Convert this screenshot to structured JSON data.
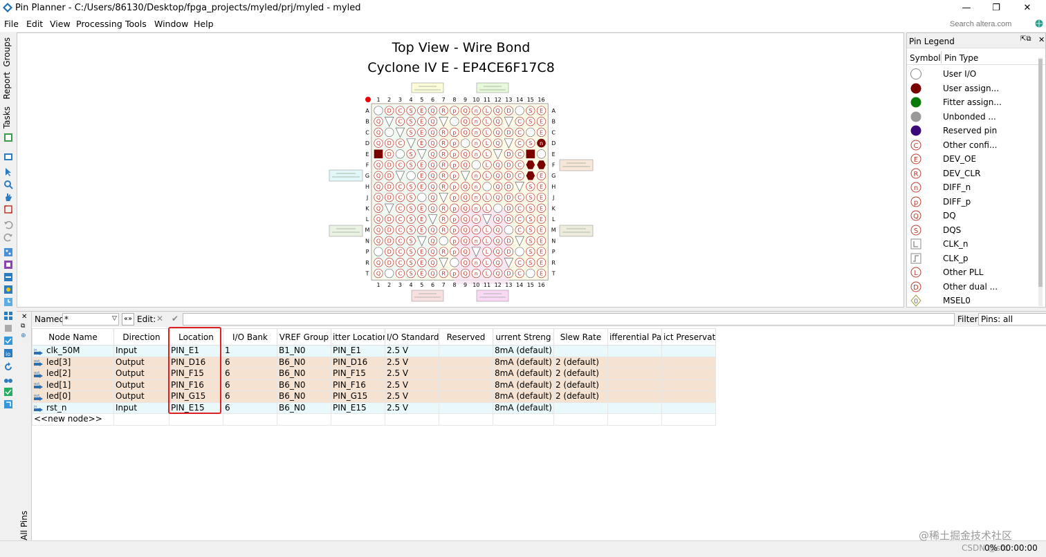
{
  "window": {
    "title": "Pin Planner - C:/Users/86130/Desktop/fpga_projects/myled/prj/myled - myled",
    "minimize": "—",
    "maximize": "❐",
    "close": "✕"
  },
  "menu": [
    "File",
    "Edit",
    "View",
    "Processing",
    "Tools",
    "Window",
    "Help"
  ],
  "search": {
    "placeholder": "Search altera.com"
  },
  "left_tabs": [
    "Groups",
    "Report",
    "Tasks"
  ],
  "top_view": {
    "title": "Top View - Wire Bond",
    "subtitle": "Cyclone IV E - EP4CE6F17C8",
    "columns": [
      "1",
      "2",
      "3",
      "4",
      "5",
      "6",
      "7",
      "8",
      "9",
      "10",
      "11",
      "12",
      "13",
      "14",
      "15",
      "16"
    ],
    "rows": [
      "A",
      "B",
      "C",
      "D",
      "E",
      "F",
      "G",
      "H",
      "J",
      "K",
      "L",
      "M",
      "N",
      "P",
      "R",
      "T"
    ]
  },
  "legend": {
    "title": "Pin Legend",
    "col_symbol": "Symbol",
    "col_type": "Pin Type",
    "items": [
      {
        "label": "User I/O",
        "sym": "circle-empty"
      },
      {
        "label": "User assign...",
        "sym": "circle-darkred"
      },
      {
        "label": "Fitter assign...",
        "sym": "circle-green"
      },
      {
        "label": "Unbonded ...",
        "sym": "circle-gray"
      },
      {
        "label": "Reserved pin",
        "sym": "circle-purple"
      },
      {
        "label": "Other confi...",
        "sym": "C"
      },
      {
        "label": "DEV_OE",
        "sym": "E"
      },
      {
        "label": "DEV_CLR",
        "sym": "R"
      },
      {
        "label": "DIFF_n",
        "sym": "n"
      },
      {
        "label": "DIFF_p",
        "sym": "p"
      },
      {
        "label": "DQ",
        "sym": "Q"
      },
      {
        "label": "DQS",
        "sym": "S"
      },
      {
        "label": "CLK_n",
        "sym": "clkn"
      },
      {
        "label": "CLK_p",
        "sym": "clkp"
      },
      {
        "label": "Other PLL",
        "sym": "L"
      },
      {
        "label": "Other dual ...",
        "sym": "D"
      },
      {
        "label": "MSEL0",
        "sym": "0"
      }
    ]
  },
  "all_pins": {
    "side_label": "All Pins",
    "named_label": "Named:",
    "named_value": "*",
    "edit_label": "Edit:",
    "filter_label": "Filter:",
    "filter_value": "Pins: all",
    "headers": [
      "Node Name",
      "Direction",
      "Location",
      "I/O Bank",
      "VREF Group",
      "Fitter Location",
      "I/O Standard",
      "Reserved",
      "Current Strength",
      "Slew Rate",
      "Differential Pair",
      "Strict Preservation"
    ],
    "headers_display": [
      "Node Name",
      "Direction",
      "Location",
      "I/O Bank",
      "VREF Group",
      "itter Locatior",
      "I/O Standard",
      "Reserved",
      "urrent Streng",
      "Slew Rate",
      "ifferential Pai",
      "ict Preservati"
    ],
    "rows": [
      {
        "dir_icon": "in",
        "name": "clk_50M",
        "direction": "Input",
        "location": "PIN_E1",
        "bank": "1",
        "vref": "B1_N0",
        "fitter": "PIN_E1",
        "std": "2.5 V",
        "reserved": "",
        "strength": "8mA (default)",
        "slew": "",
        "diff": "",
        "strict": ""
      },
      {
        "dir_icon": "out",
        "name": "led[3]",
        "direction": "Output",
        "location": "PIN_D16",
        "bank": "6",
        "vref": "B6_N0",
        "fitter": "PIN_D16",
        "std": "2.5 V",
        "reserved": "",
        "strength": "8mA (default)",
        "slew": "2 (default)",
        "diff": "",
        "strict": ""
      },
      {
        "dir_icon": "out",
        "name": "led[2]",
        "direction": "Output",
        "location": "PIN_F15",
        "bank": "6",
        "vref": "B6_N0",
        "fitter": "PIN_F15",
        "std": "2.5 V",
        "reserved": "",
        "strength": "8mA (default)",
        "slew": "2 (default)",
        "diff": "",
        "strict": ""
      },
      {
        "dir_icon": "out",
        "name": "led[1]",
        "direction": "Output",
        "location": "PIN_F16",
        "bank": "6",
        "vref": "B6_N0",
        "fitter": "PIN_F16",
        "std": "2.5 V",
        "reserved": "",
        "strength": "8mA (default)",
        "slew": "2 (default)",
        "diff": "",
        "strict": ""
      },
      {
        "dir_icon": "out",
        "name": "led[0]",
        "direction": "Output",
        "location": "PIN_G15",
        "bank": "6",
        "vref": "B6_N0",
        "fitter": "PIN_G15",
        "std": "2.5 V",
        "reserved": "",
        "strength": "8mA (default)",
        "slew": "2 (default)",
        "diff": "",
        "strict": ""
      },
      {
        "dir_icon": "in",
        "name": "rst_n",
        "direction": "Input",
        "location": "PIN_E15",
        "bank": "6",
        "vref": "B6_N0",
        "fitter": "PIN_E15",
        "std": "2.5 V",
        "reserved": "",
        "strength": "8mA (default)",
        "slew": "",
        "diff": "",
        "strict": ""
      }
    ],
    "new_node": "<<new node>>"
  },
  "status": {
    "progress": "0%",
    "time": "00:00:00",
    "csdn": "CSDN @stc",
    "watermark": "@稀土掘金技术社区"
  },
  "colors": {
    "input_row": "#e8f8fb",
    "output_row": "#f5e2d0",
    "highlight": "#e02020",
    "user_assigned": "#7a0000"
  }
}
